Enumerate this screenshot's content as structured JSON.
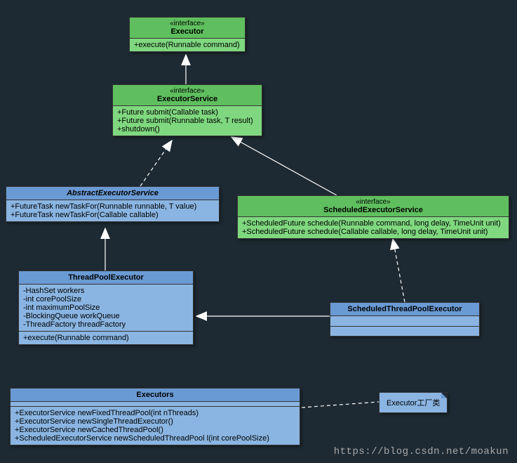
{
  "colors": {
    "interface": "#5fbf5f",
    "class": "#6a9ad4",
    "bg": "#1e2a33"
  },
  "executor": {
    "stereo": "«interface»",
    "name": "Executor",
    "m1": "+execute(Runnable command)"
  },
  "execService": {
    "stereo": "«interface»",
    "name": "ExecutorService",
    "m1": "+Future submit(Callable task)",
    "m2": "+Future submit(Runnable task, T result)",
    "m3": "+shutdown()"
  },
  "absExec": {
    "name": "AbstractExecutorService",
    "m1": "+FutureTask  newTaskFor(Runnable runnable, T value)",
    "m2": "+FutureTask  newTaskFor(Callable  callable)"
  },
  "schedService": {
    "stereo": "«interface»",
    "name": "ScheduledExecutorService",
    "m1": "+ScheduledFuture schedule(Runnable command, long delay, TimeUnit unit)",
    "m2": "+ScheduledFuture schedule(Callable callable, long delay, TimeUnit unit)"
  },
  "tpe": {
    "name": "ThreadPoolExecutor",
    "a1": "-HashSet  workers",
    "a2": "-int  corePoolSize",
    "a3": "-int maximumPoolSize",
    "a4": "-BlockingQueue workQueue",
    "a5": "-ThreadFactory threadFactory",
    "m1": "+execute(Runnable command)"
  },
  "stpe": {
    "name": "ScheduledThreadPoolExecutor"
  },
  "executors": {
    "name": "Executors",
    "m1": "+ExecutorService newFixedThreadPool(int nThreads)",
    "m2": "+ExecutorService newSingleThreadExecutor()",
    "m3": "+ExecutorService newCachedThreadPool()",
    "m4": "+ScheduledExecutorService  newScheduledThreadPool l(int corePoolSize)"
  },
  "note": {
    "text": "Executor工厂类"
  },
  "watermark": "https://blog.csdn.net/moakun",
  "chart_data": {
    "type": "uml-class-diagram",
    "classes": [
      {
        "name": "Executor",
        "kind": "interface",
        "methods": [
          "+execute(Runnable command)"
        ]
      },
      {
        "name": "ExecutorService",
        "kind": "interface",
        "methods": [
          "+Future submit(Callable task)",
          "+Future submit(Runnable task, T result)",
          "+shutdown()"
        ]
      },
      {
        "name": "AbstractExecutorService",
        "kind": "abstract",
        "methods": [
          "+FutureTask newTaskFor(Runnable runnable, T value)",
          "+FutureTask newTaskFor(Callable callable)"
        ]
      },
      {
        "name": "ScheduledExecutorService",
        "kind": "interface",
        "methods": [
          "+ScheduledFuture schedule(Runnable command, long delay, TimeUnit unit)",
          "+ScheduledFuture schedule(Callable callable, long delay, TimeUnit unit)"
        ]
      },
      {
        "name": "ThreadPoolExecutor",
        "kind": "class",
        "attributes": [
          "-HashSet workers",
          "-int corePoolSize",
          "-int maximumPoolSize",
          "-BlockingQueue workQueue",
          "-ThreadFactory threadFactory"
        ],
        "methods": [
          "+execute(Runnable command)"
        ]
      },
      {
        "name": "ScheduledThreadPoolExecutor",
        "kind": "class"
      },
      {
        "name": "Executors",
        "kind": "class",
        "methods": [
          "+ExecutorService newFixedThreadPool(int nThreads)",
          "+ExecutorService newSingleThreadExecutor()",
          "+ExecutorService newCachedThreadPool()",
          "+ScheduledExecutorService newScheduledThreadPool(int corePoolSize)"
        ]
      }
    ],
    "relations": [
      {
        "from": "ExecutorService",
        "to": "Executor",
        "type": "extends"
      },
      {
        "from": "AbstractExecutorService",
        "to": "ExecutorService",
        "type": "implements"
      },
      {
        "from": "ScheduledExecutorService",
        "to": "ExecutorService",
        "type": "extends"
      },
      {
        "from": "ThreadPoolExecutor",
        "to": "AbstractExecutorService",
        "type": "extends"
      },
      {
        "from": "ScheduledThreadPoolExecutor",
        "to": "ThreadPoolExecutor",
        "type": "extends"
      },
      {
        "from": "ScheduledThreadPoolExecutor",
        "to": "ScheduledExecutorService",
        "type": "implements"
      },
      {
        "from": "Executors",
        "to": "note:Executor工厂类",
        "type": "note"
      }
    ]
  }
}
